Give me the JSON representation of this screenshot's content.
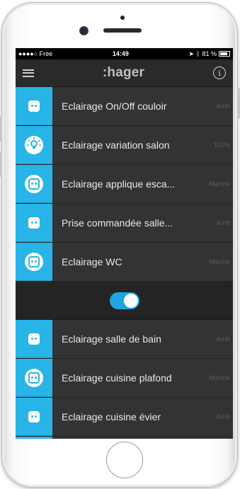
{
  "statusbar": {
    "carrier": "●●●●○ Free",
    "time": "14:49",
    "battery": "81 %"
  },
  "navbar": {
    "brand": ":hager"
  },
  "items": [
    {
      "label": "Eclairage On/Off couloir",
      "state": "Arrêt",
      "icon": "plug-icon"
    },
    {
      "label": "Eclairage variation salon",
      "state": "100%",
      "icon": "dimmer-bulb-icon"
    },
    {
      "label": "Eclairage applique esca...",
      "state": "Marche",
      "icon": "plug-icon"
    },
    {
      "label": "Prise commandée salle...",
      "state": "Arrêt",
      "icon": "plug-icon"
    },
    {
      "label": "Eclairage WC",
      "state": "Marche",
      "icon": "plug-icon"
    }
  ],
  "toggle": {
    "on": true,
    "color": "#1ea6e2"
  },
  "items2": [
    {
      "label": "Eclairage salle de bain",
      "state": "Arrêt",
      "icon": "plug-icon"
    },
    {
      "label": "Eclairage cuisine plafond",
      "state": "Marche",
      "icon": "plug-icon"
    },
    {
      "label": "Eclairage cuisine évier",
      "state": "Arrêt",
      "icon": "plug-icon"
    }
  ],
  "colors": {
    "accent": "#28b4e6",
    "background": "#333333"
  }
}
